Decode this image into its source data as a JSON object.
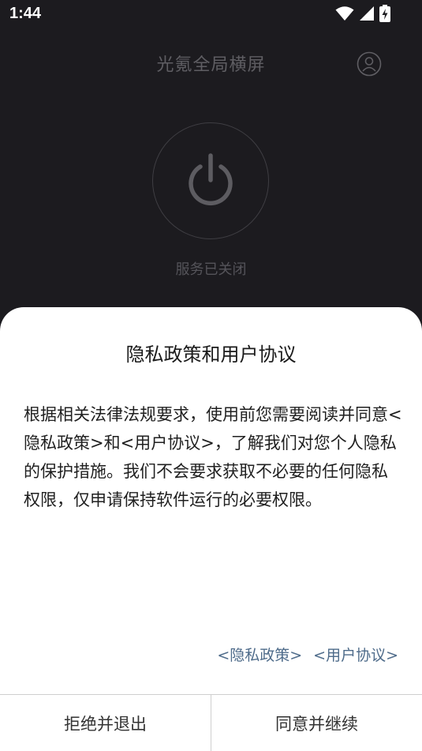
{
  "status_bar": {
    "time": "1:44",
    "icons": [
      "wifi-icon",
      "signal-icon",
      "battery-charging-icon"
    ]
  },
  "header": {
    "title": "光氪全局横屏",
    "account_icon": "account-icon"
  },
  "power": {
    "icon": "power-icon",
    "status": "服务已关闭"
  },
  "dialog": {
    "title": "隐私政策和用户协议",
    "body": "根据相关法律法规要求，使用前您需要阅读并同意<隐私政策>和<用户协议>，了解我们对您个人隐私的保护措施。我们不会要求获取不必要的任何隐私权限，仅申请保持软件运行的必要权限。",
    "links": {
      "privacy": "<隐私政策>",
      "agreement": "<用户协议>"
    },
    "actions": {
      "decline": "拒绝并退出",
      "accept": "同意并继续"
    }
  },
  "colors": {
    "background": "#1c1b1f",
    "dialog": "#ffffff",
    "link": "#4e6b8a",
    "muted": "#5f5e63"
  }
}
